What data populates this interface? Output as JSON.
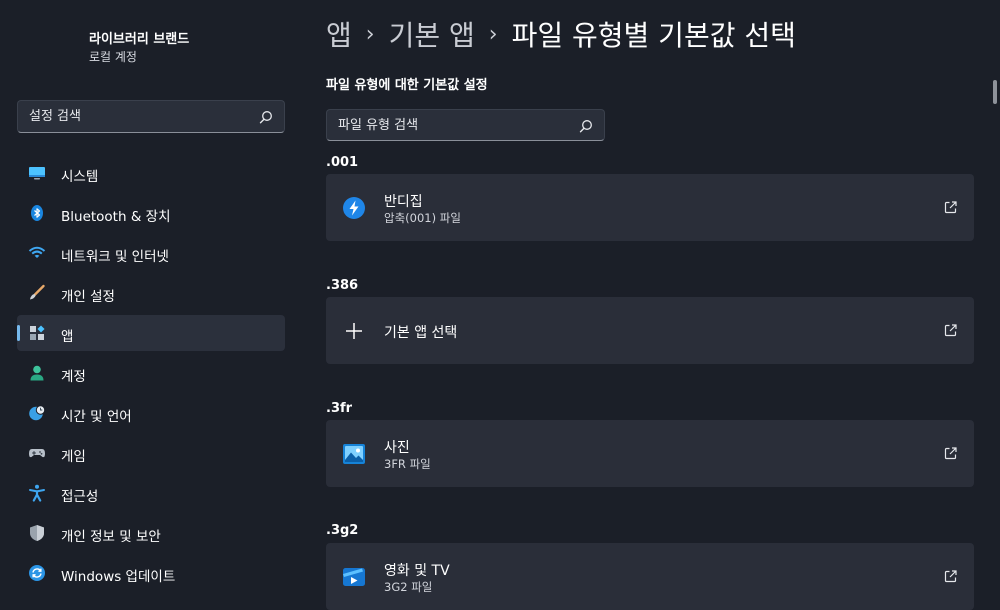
{
  "account": {
    "name": "라이브러리 브랜드",
    "type": "로컬 계정"
  },
  "sidebar": {
    "search_placeholder": "설정 검색",
    "items": [
      {
        "label": "시스템",
        "icon": "monitor-icon"
      },
      {
        "label": "Bluetooth & 장치",
        "icon": "bluetooth-icon"
      },
      {
        "label": "네트워크 및 인터넷",
        "icon": "wifi-icon"
      },
      {
        "label": "개인 설정",
        "icon": "brush-icon"
      },
      {
        "label": "앱",
        "icon": "apps-icon",
        "active": true
      },
      {
        "label": "계정",
        "icon": "person-icon"
      },
      {
        "label": "시간 및 언어",
        "icon": "clock-globe-icon"
      },
      {
        "label": "게임",
        "icon": "gamepad-icon"
      },
      {
        "label": "접근성",
        "icon": "accessibility-icon"
      },
      {
        "label": "개인 정보 및 보안",
        "icon": "shield-icon"
      },
      {
        "label": "Windows 업데이트",
        "icon": "update-icon"
      }
    ]
  },
  "breadcrumb": {
    "level1": "앱",
    "level2": "기본 앱",
    "current": "파일 유형별 기본값 선택",
    "separator": "›"
  },
  "main": {
    "section_title": "파일 유형에 대한 기본값 설정",
    "search_placeholder": "파일 유형 검색",
    "entries": [
      {
        "ext": ".001",
        "app": "반디집",
        "desc": "압축(001) 파일",
        "icon": "bandizip-icon"
      },
      {
        "ext": ".386",
        "app": "기본 앱 선택",
        "desc": "",
        "icon": "plus-icon"
      },
      {
        "ext": ".3fr",
        "app": "사진",
        "desc": "3FR 파일",
        "icon": "photos-icon"
      },
      {
        "ext": ".3g2",
        "app": "영화 및 TV",
        "desc": "3G2 파일",
        "icon": "movies-tv-icon"
      }
    ]
  },
  "colors": {
    "accent": "#76b9ed",
    "background": "#1b1f28",
    "card": "#2a2e39"
  }
}
